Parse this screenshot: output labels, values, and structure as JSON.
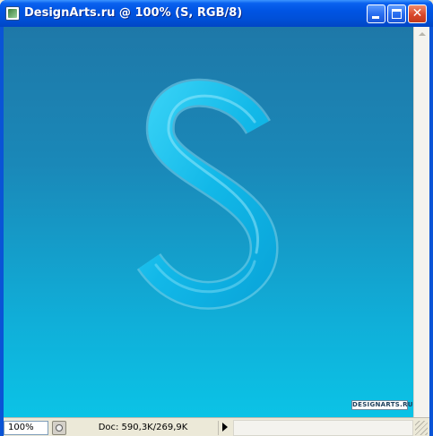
{
  "window": {
    "title": "DesignArts.ru @ 100% (S, RGB/8)",
    "icon": "photoshop-document-icon",
    "controls": {
      "minimize_icon": "minimize-icon",
      "maximize_icon": "maximize-icon",
      "close_icon": "close-icon",
      "close_glyph": "✕"
    }
  },
  "canvas": {
    "artwork_letter": "S",
    "gradient_colors": [
      "#1e78a8",
      "#0bc3e6"
    ],
    "letter_color": "#12b8e8",
    "watermark": "DESIGNARTS.RU"
  },
  "statusbar": {
    "zoom": "100%",
    "history_icon": "history-clock-icon",
    "doc_info": "Doc: 590,3K/269,9K",
    "menu_arrow_icon": "play-arrow-icon"
  }
}
